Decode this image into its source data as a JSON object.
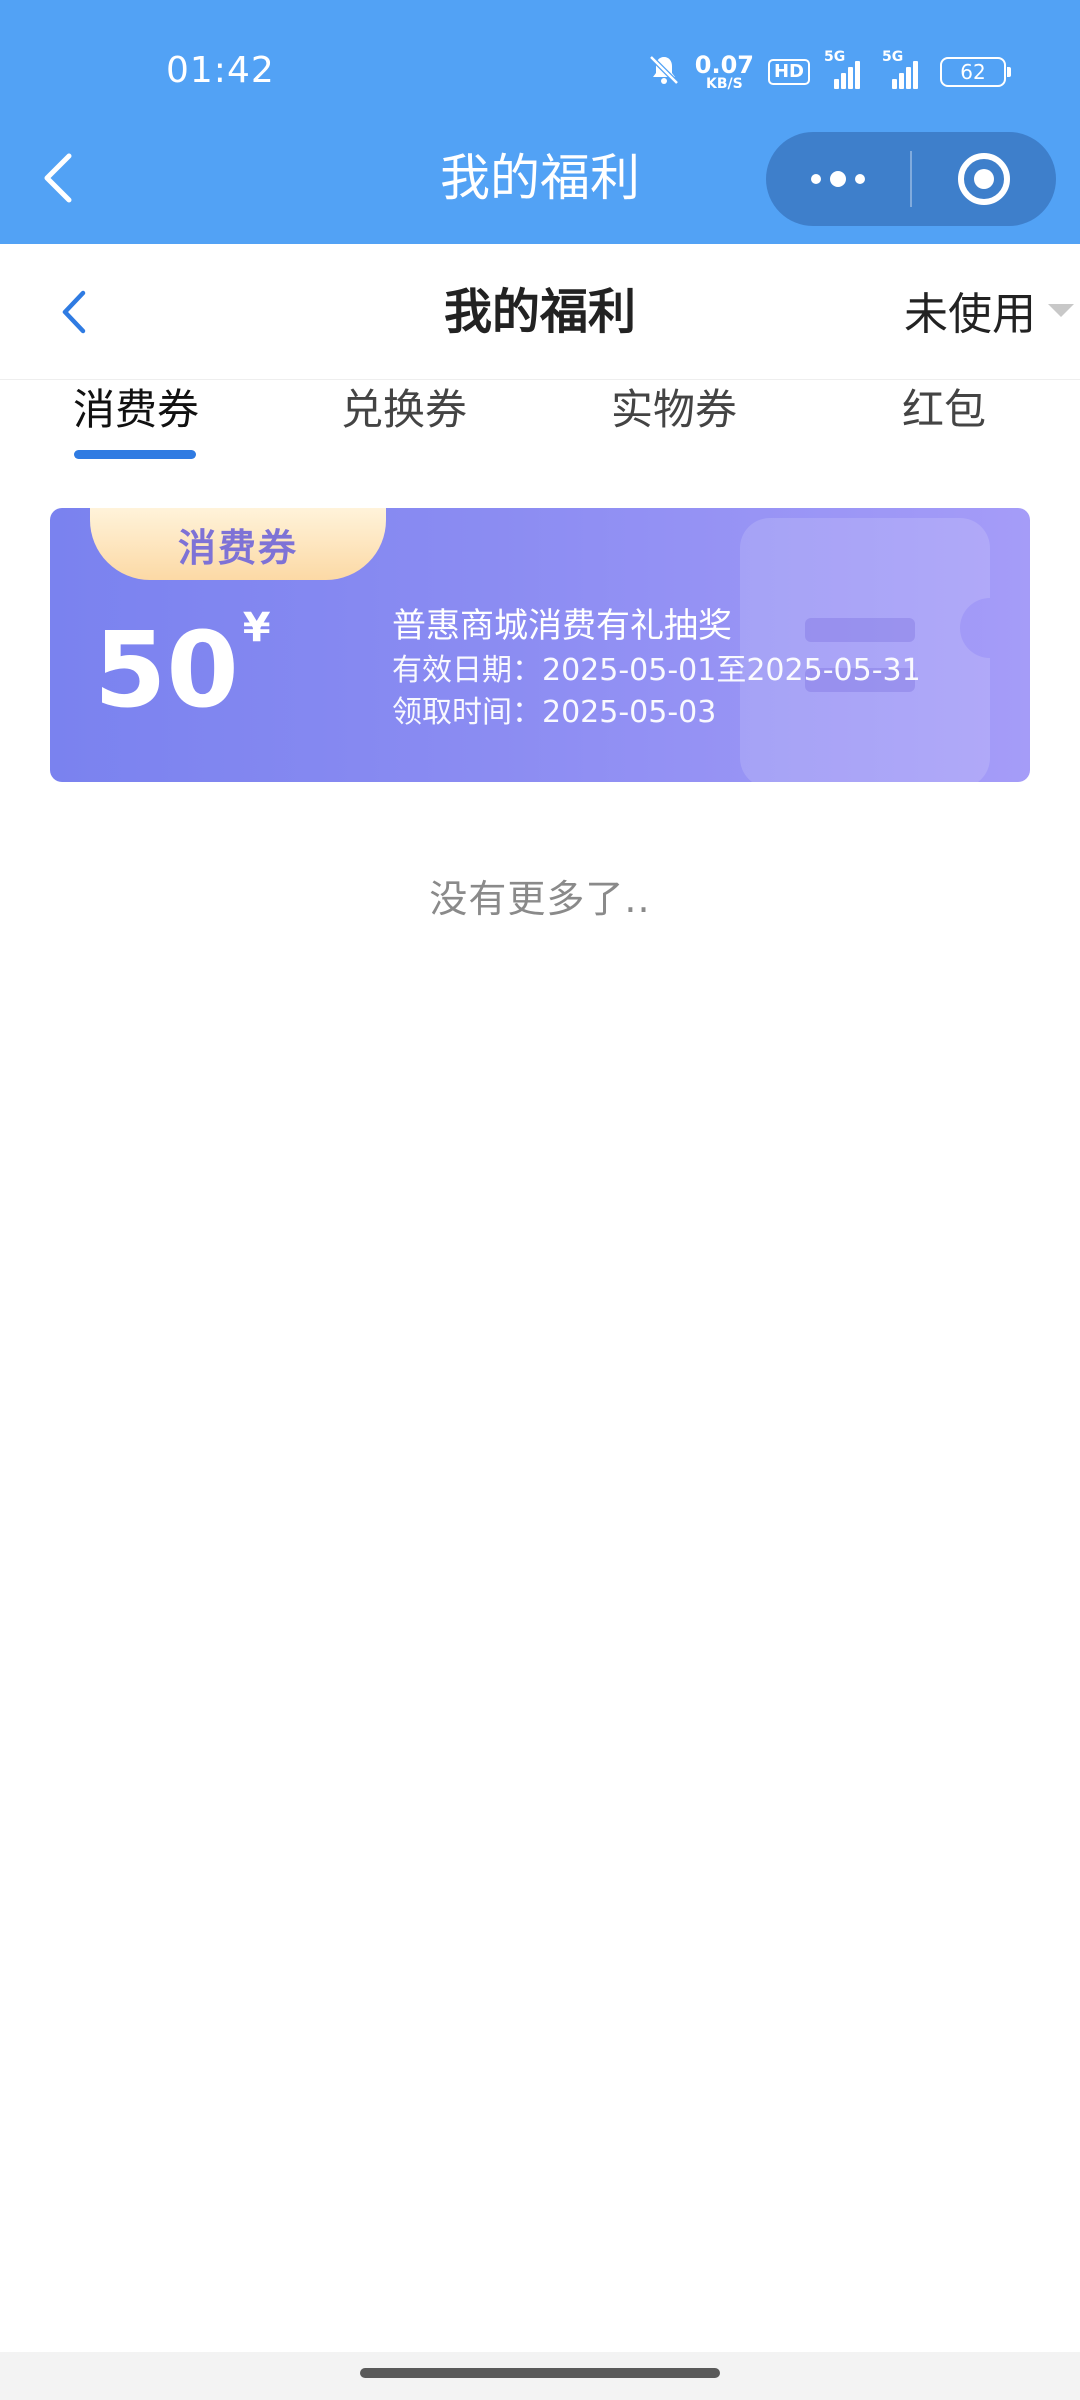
{
  "status_bar": {
    "time": "01:42",
    "net_speed_value": "0.07",
    "net_speed_unit": "KB/S",
    "hd_badge": "HD",
    "signal_1_label": "5G",
    "signal_2_label": "5G",
    "battery": "62"
  },
  "mini_program_nav": {
    "title": "我的福利"
  },
  "page_header": {
    "title": "我的福利",
    "filter_label": "未使用"
  },
  "tabs": [
    {
      "label": "消费券",
      "active": true
    },
    {
      "label": "兑换券",
      "active": false
    },
    {
      "label": "实物券",
      "active": false
    },
    {
      "label": "红包",
      "active": false
    }
  ],
  "coupon": {
    "ribbon_label": "消费券",
    "amount": "50",
    "currency": "¥",
    "name": "普惠商城消费有礼抽奖",
    "valid_label": "有效日期：",
    "valid_range": "2025-05-01至2025-05-31",
    "received_label": "领取时间：",
    "received_date": "2025-05-03"
  },
  "list_end_text": "没有更多了..",
  "colors": {
    "nav_blue": "#52a2f5",
    "tab_active": "#2f7be2",
    "coupon_start": "#7a82ef",
    "coupon_end": "#a59cf8"
  }
}
